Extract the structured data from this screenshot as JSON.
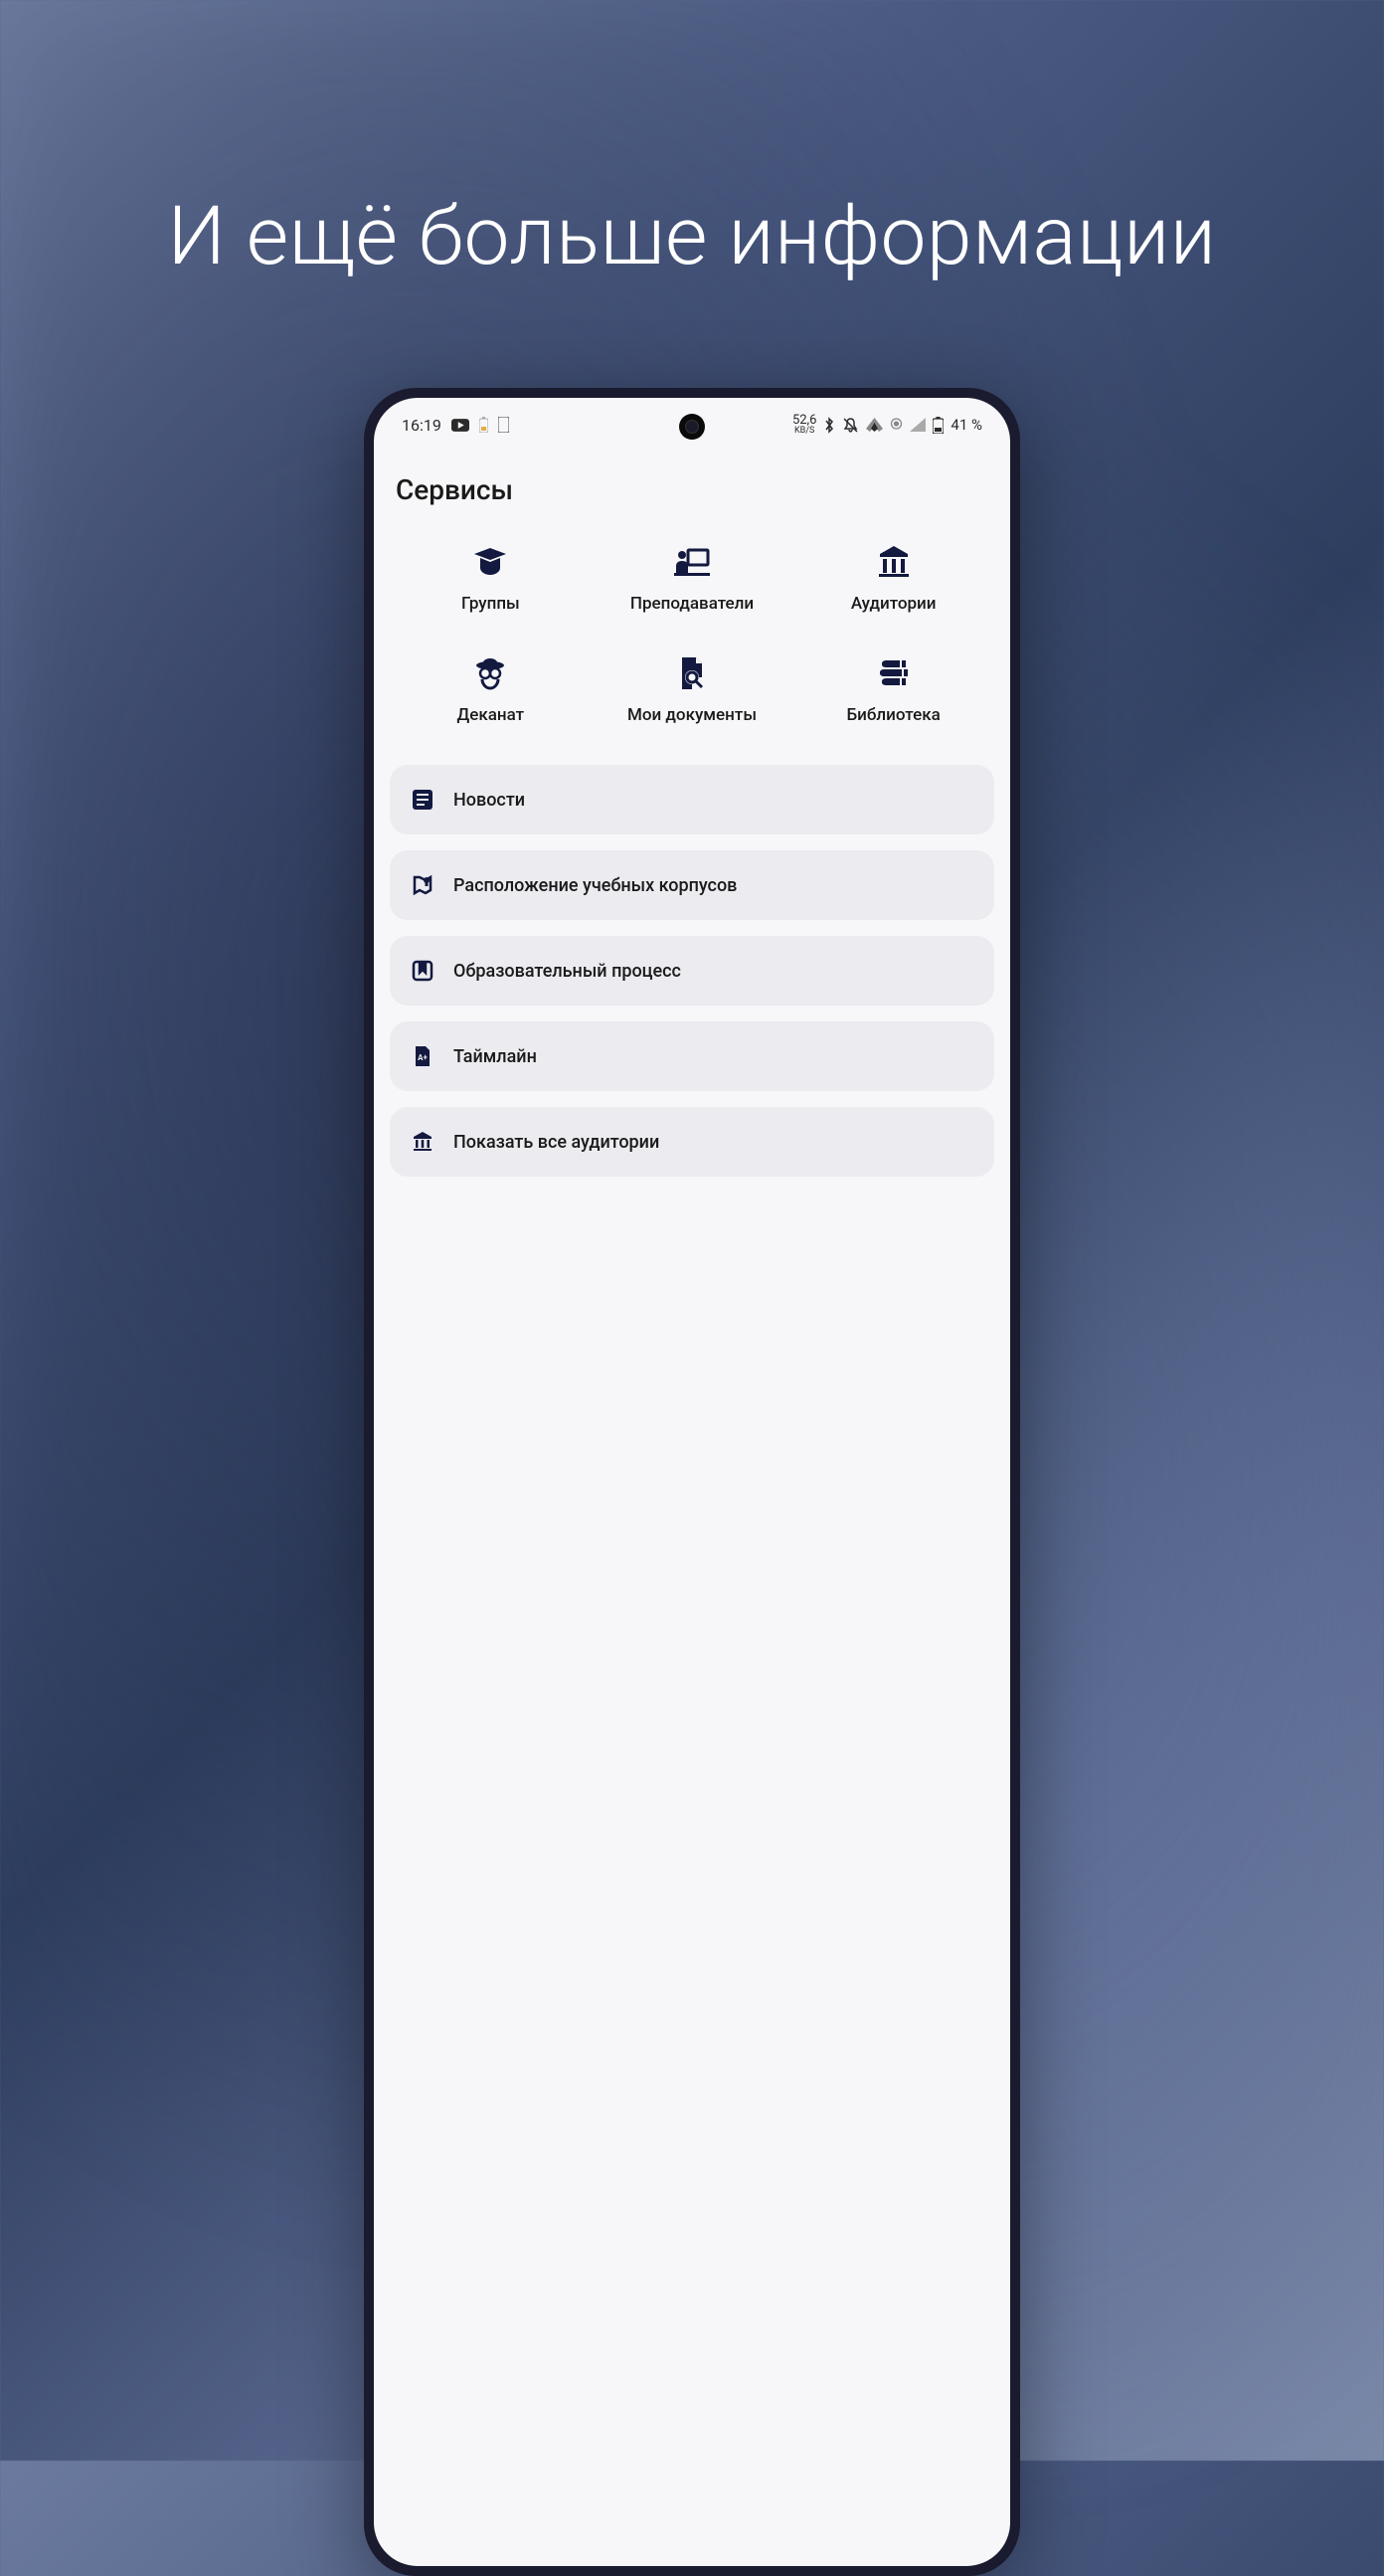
{
  "promo": {
    "headline": "И ещё больше информации"
  },
  "statusbar": {
    "time": "16:19",
    "network_speed": "52,6",
    "network_unit": "KB/S",
    "battery_text": "41 %"
  },
  "page": {
    "title": "Сервисы"
  },
  "tiles": [
    {
      "icon": "graduation-cap",
      "label": "Группы"
    },
    {
      "icon": "teacher",
      "label": "Преподаватели"
    },
    {
      "icon": "building",
      "label": "Аудитории"
    },
    {
      "icon": "user-secret",
      "label": "Деканат"
    },
    {
      "icon": "file-search",
      "label": "Мои документы"
    },
    {
      "icon": "books",
      "label": "Библиотека"
    }
  ],
  "list": [
    {
      "icon": "news",
      "label": "Новости"
    },
    {
      "icon": "map-pin",
      "label": "Расположение учебных корпусов"
    },
    {
      "icon": "bookmark",
      "label": "Образовательный процесс"
    },
    {
      "icon": "grade",
      "label": "Таймлайн"
    },
    {
      "icon": "bank",
      "label": "Показать все аудитории"
    }
  ]
}
